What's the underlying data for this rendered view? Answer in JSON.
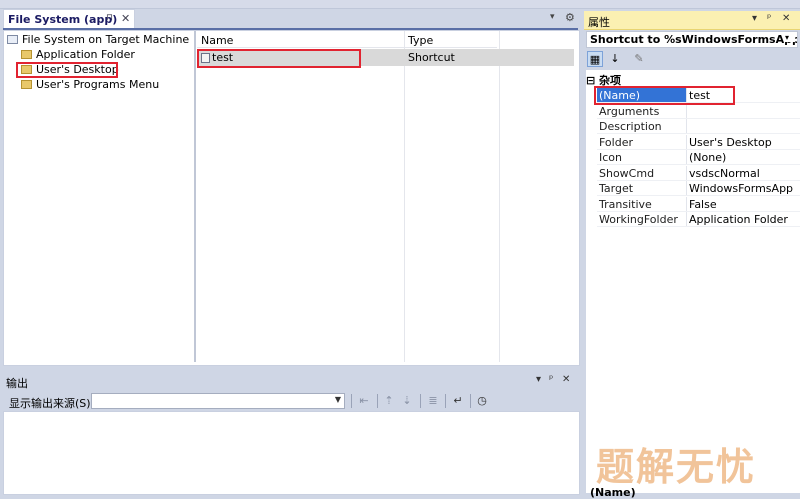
{
  "file_system": {
    "tab_title": "File System (app)",
    "pin_glyph": "⊓",
    "close_glyph": "✕",
    "menu_glyph": "▾",
    "gear_glyph": "⚙",
    "tree": {
      "root": "File System on Target Machine",
      "items": [
        "Application Folder",
        "User's Desktop",
        "User's Programs Menu"
      ],
      "selected": "User's Desktop"
    },
    "list": {
      "columns": [
        "Name",
        "Type"
      ],
      "rows": [
        {
          "name": "test",
          "type": "Shortcut"
        }
      ]
    }
  },
  "output": {
    "title": "输出",
    "source_label": "显示输出来源(S):",
    "source_value": "",
    "controls": [
      "▾",
      "ᵖ",
      "✕"
    ]
  },
  "properties": {
    "title": "属性",
    "object": "Shortcut to %sWindowsFormsApp.exe",
    "category": "⊟ 杂项",
    "rows": [
      {
        "key": "(Name)",
        "value": "test"
      },
      {
        "key": "Arguments",
        "value": ""
      },
      {
        "key": "Description",
        "value": ""
      },
      {
        "key": "Folder",
        "value": "User's Desktop"
      },
      {
        "key": "Icon",
        "value": "(None)"
      },
      {
        "key": "ShowCmd",
        "value": "vsdscNormal"
      },
      {
        "key": "Target",
        "value": "WindowsFormsApp"
      },
      {
        "key": "Transitive",
        "value": "False"
      },
      {
        "key": "WorkingFolder",
        "value": "Application Folder"
      }
    ],
    "description_title": "(Name)"
  },
  "watermark": "题解无忧",
  "colors": {
    "highlight_red": "#e12330",
    "selection_blue": "#3373d6",
    "tool_title_yellow": "#fbf0b2"
  }
}
